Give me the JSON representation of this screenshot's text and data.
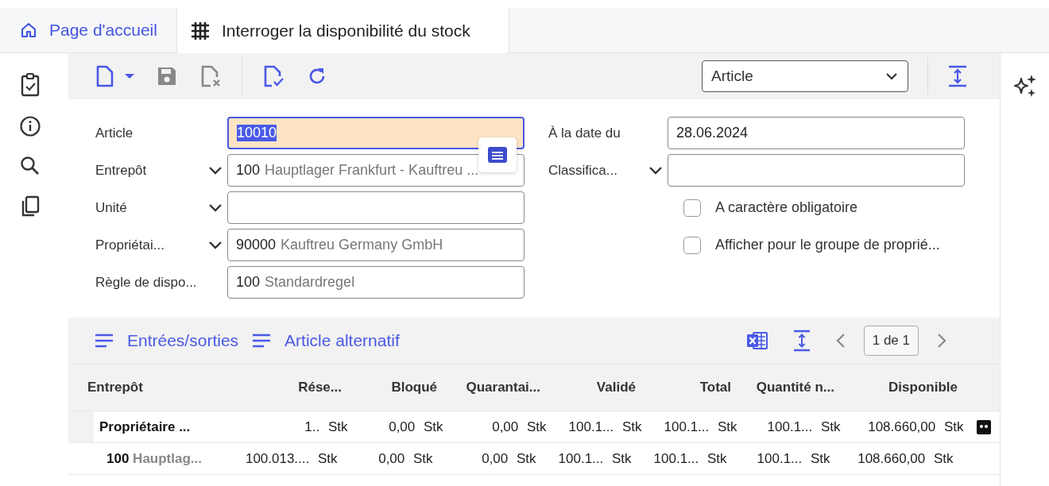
{
  "tabs": [
    {
      "label": "Page d'accueil",
      "selected": false
    },
    {
      "label": "Interroger la disponibilité du stock",
      "selected": true
    }
  ],
  "toolbar": {
    "view_select": {
      "value": "Article"
    }
  },
  "form": {
    "left": [
      {
        "label": "Article",
        "dropdown": false,
        "code": "10010",
        "focused": true
      },
      {
        "label": "Entrepôt",
        "dropdown": true,
        "code": "100",
        "description": "Hauptlager Frankfurt -  Kauftreu ...",
        "focused": false
      },
      {
        "label": "Unité",
        "dropdown": true,
        "focused": false
      },
      {
        "label": "Propriétai...",
        "dropdown": true,
        "code": "90000",
        "description": "Kauftreu Germany GmbH",
        "focused": false
      },
      {
        "label": "Règle de dispo...",
        "dropdown": false,
        "code": "100",
        "description": "Standardregel",
        "focused": false
      }
    ],
    "right": [
      {
        "label": "À la date du",
        "dropdown": false,
        "code": "28.06.2024"
      },
      {
        "label": "Classifica...",
        "dropdown": true
      }
    ],
    "checkboxes": [
      {
        "label": "A caractère obligatoire",
        "checked": false
      },
      {
        "label": "Afficher pour le groupe de proprié...",
        "checked": false
      }
    ]
  },
  "grid": {
    "links": [
      "Entrées/sorties",
      "Article alternatif"
    ],
    "pager": "1 de 1",
    "columns": [
      "Entrepôt",
      "Rése...",
      "Bloqué",
      "Quarantai...",
      "Validé",
      "Total",
      "Quantité n...",
      "Disponible"
    ],
    "rows": [
      {
        "kind": "group",
        "marker": true,
        "cells": [
          {
            "value": "Propriétaire ..."
          },
          {
            "value": "1..",
            "unit": "Stk"
          },
          {
            "value": "0,00",
            "unit": "Stk"
          },
          {
            "value": "0,00",
            "unit": "Stk"
          },
          {
            "value": "100.1...",
            "unit": "Stk"
          },
          {
            "value": "100.1...",
            "unit": "Stk"
          },
          {
            "value": "100.1...",
            "unit": "Stk"
          },
          {
            "value": "108.660,00",
            "unit": "Stk"
          }
        ]
      },
      {
        "kind": "item",
        "marker": false,
        "cells": [
          {
            "value": "100",
            "description": "Hauptlag..."
          },
          {
            "value": "100.013....",
            "unit": "Stk"
          },
          {
            "value": "0,00",
            "unit": "Stk"
          },
          {
            "value": "0,00",
            "unit": "Stk"
          },
          {
            "value": "100.1...",
            "unit": "Stk"
          },
          {
            "value": "100.1...",
            "unit": "Stk"
          },
          {
            "value": "100.1...",
            "unit": "Stk"
          },
          {
            "value": "108.660,00",
            "unit": "Stk"
          }
        ]
      }
    ]
  }
}
